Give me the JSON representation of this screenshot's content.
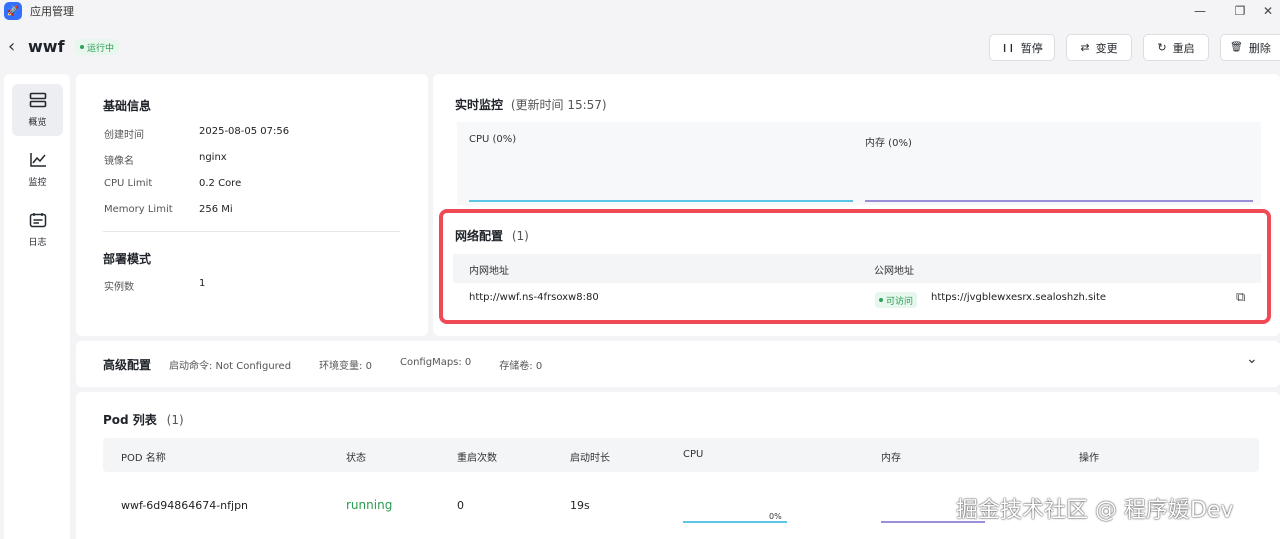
{
  "window": {
    "app_icon": "rocket-icon",
    "title": "应用管理",
    "minimize_glyph": "—",
    "restore_glyph": "❐",
    "close_glyph": "✕"
  },
  "header": {
    "back_glyph": "‹",
    "app_name": "wwf",
    "status": "运行中",
    "buttons": {
      "pause": {
        "icon": "pause-icon",
        "glyph": "❙❙",
        "label": "暂停"
      },
      "update": {
        "icon": "swap-icon",
        "glyph": "⇄",
        "label": "变更"
      },
      "restart": {
        "icon": "restart-icon",
        "glyph": "↻",
        "label": "重启"
      },
      "delete": {
        "icon": "trash-icon",
        "glyph": "🗑",
        "label": "删除"
      }
    }
  },
  "sidebar": {
    "items": [
      {
        "icon": "overview-icon",
        "glyph": "☰",
        "label": "概览",
        "active": true
      },
      {
        "icon": "chart-icon",
        "glyph": "📈",
        "label": "监控",
        "active": false
      },
      {
        "icon": "calendar-icon",
        "glyph": "📅",
        "label": "日志",
        "active": false
      }
    ]
  },
  "basic_info": {
    "title": "基础信息",
    "rows": [
      {
        "key": "创建时间",
        "value": "2025-08-05 07:56"
      },
      {
        "key": "镜像名",
        "value": "nginx"
      },
      {
        "key": "CPU Limit",
        "value": "0.2 Core"
      },
      {
        "key": "Memory Limit",
        "value": "256 Mi"
      }
    ],
    "deploy_title": "部署模式",
    "deploy_rows": [
      {
        "key": "实例数",
        "value": "1"
      }
    ]
  },
  "monitor": {
    "title": "实时监控",
    "update_time": "(更新时间 15:57)",
    "cpu_label": "CPU (0%)",
    "mem_label": "内存 (0%)",
    "cpu_color": "#5bc6e8",
    "mem_color": "#9b8fd9"
  },
  "network": {
    "title": "网络配置",
    "count": "(1)",
    "col_internal": "内网地址",
    "col_public": "公网地址",
    "internal_address": "http://wwf.ns-4frsoxw8:80",
    "access_status": "可访问",
    "public_address": "https://jvgblewxesrx.sealoshzh.site",
    "copy_icon": "copy-icon",
    "copy_glyph": "⧉",
    "highlight_color": "#f04a57"
  },
  "advanced": {
    "title": "高级配置",
    "items": [
      "启动命令: Not Configured",
      "环境变量: 0",
      "ConfigMaps: 0",
      "存储卷: 0"
    ],
    "expand_glyph": "⌄"
  },
  "pods": {
    "title": "Pod 列表",
    "count": "(1)",
    "columns": [
      "POD 名称",
      "状态",
      "重启次数",
      "启动时长",
      "CPU",
      "内存",
      "操作"
    ],
    "rows": [
      {
        "name": "wwf-6d94864674-nfjpn",
        "status": "running",
        "restarts": "0",
        "uptime": "19s",
        "cpu": "0%"
      }
    ],
    "running_color": "#2a9d4f"
  },
  "watermark": "掘金技术社区 @ 程序媛Dev"
}
